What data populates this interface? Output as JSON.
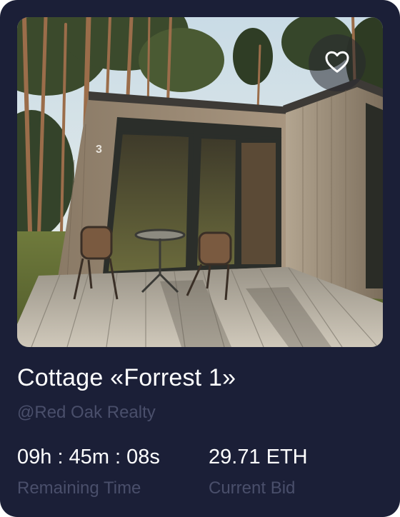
{
  "card": {
    "title": "Cottage «Forrest 1»",
    "owner": "@Red Oak Realty",
    "image_icon": "cottage-photo",
    "favorite_icon": "heart-icon",
    "stats": {
      "remaining_time": {
        "value": "09h : 45m : 08s",
        "label": "Remaining Time"
      },
      "current_bid": {
        "value": "29.71 ETH",
        "label": "Current Bid"
      }
    }
  },
  "colors": {
    "card_bg": "#1b1f37",
    "text_primary": "#ffffff",
    "text_secondary": "#4a4f6b"
  }
}
